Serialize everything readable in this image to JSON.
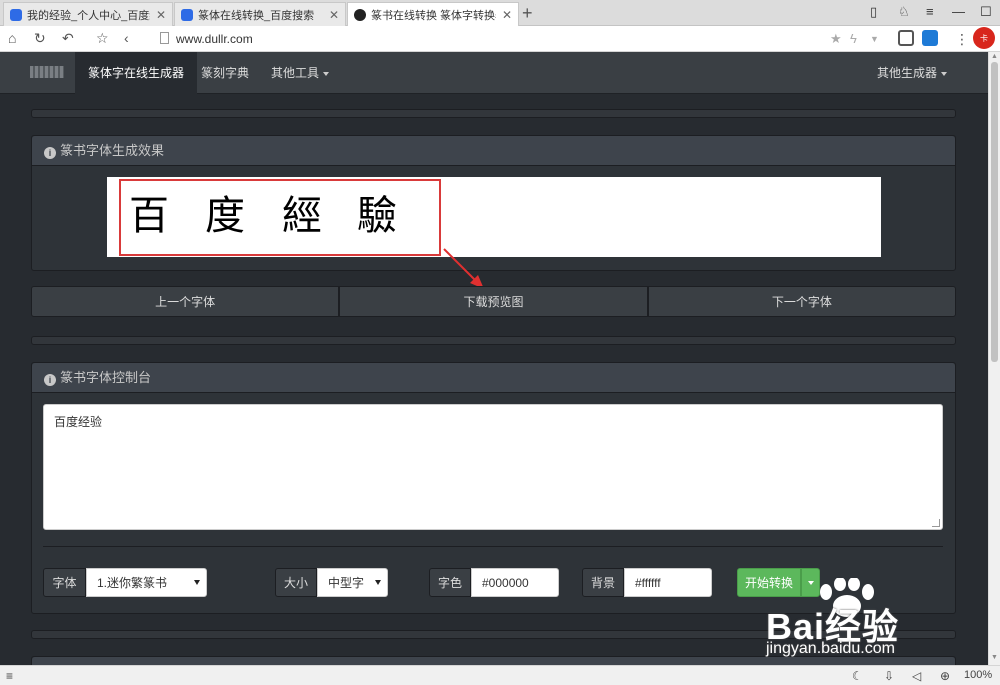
{
  "browser": {
    "tabs": [
      {
        "title": "我的经验_个人中心_百度经验",
        "icon": "baidu-paw-icon"
      },
      {
        "title": "篆体在线转换_百度搜索",
        "icon": "baidu-paw-icon"
      },
      {
        "title": "篆书在线转换 篆体字转换器",
        "icon": "ink-logo-icon",
        "active": true
      }
    ],
    "url": "www.dullr.com",
    "zoom": "100%"
  },
  "site": {
    "nav": {
      "items": [
        "篆体字在线生成器",
        "篆刻字典",
        "其他工具"
      ],
      "right": "其他生成器"
    },
    "preview_panel": {
      "title": "篆书字体生成效果",
      "preview_chars": [
        "百",
        "度",
        "經",
        "驗"
      ]
    },
    "buttons": {
      "prev": "上一个字体",
      "download": "下载预览图",
      "next": "下一个字体"
    },
    "control_panel": {
      "title": "篆书字体控制台",
      "text": "百度经验",
      "font_label": "字体",
      "font_value": "1.迷你繁篆书",
      "size_label": "大小",
      "size_value": "中型字",
      "color_label": "字色",
      "color_value": "#000000",
      "bg_label": "背景",
      "bg_value": "#ffffff",
      "convert": "开始转换"
    }
  },
  "watermark": {
    "text": "Bai经验",
    "url": "jingyan.baidu.com"
  },
  "colors": {
    "page_bg": "#272b30",
    "navbar": "#3a3f44",
    "accent_green": "#5cb85c",
    "highlight_red": "#d93a3a"
  }
}
